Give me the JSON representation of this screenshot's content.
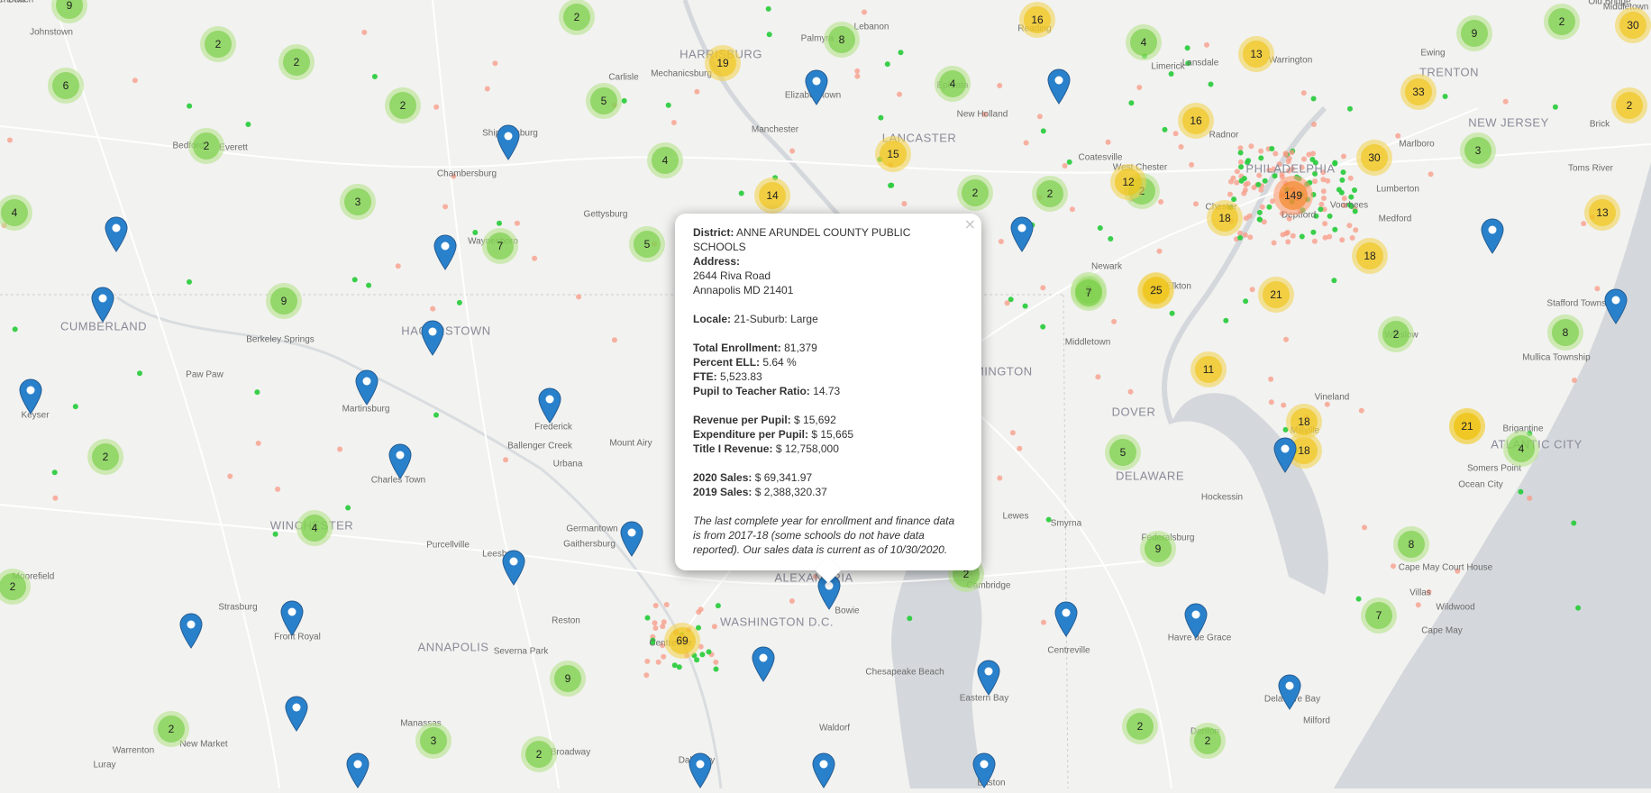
{
  "map": {
    "colors": {
      "land": "#f2f2f0",
      "water": "#d4d8dc",
      "road": "#ffffff",
      "border": "#c9c9c9",
      "dot_red": "#f89a85",
      "dot_green": "#2ecc40",
      "marker_blue": "#2a81cb"
    },
    "place_labels": [
      {
        "text": "Johnstown",
        "big": false
      },
      {
        "text": "Bedford",
        "big": false
      },
      {
        "text": "Everett",
        "big": false
      },
      {
        "text": "Shippensburg",
        "big": false
      },
      {
        "text": "Chambersburg",
        "big": false
      },
      {
        "text": "Waynesboro",
        "big": false
      },
      {
        "text": "Gettysburg",
        "big": false
      },
      {
        "text": "HARRISBURG",
        "big": true
      },
      {
        "text": "Mechanicsburg",
        "big": false
      },
      {
        "text": "Carlisle",
        "big": false
      },
      {
        "text": "Elizabethtown",
        "big": false
      },
      {
        "text": "Palmyra",
        "big": false
      },
      {
        "text": "Lebanon",
        "big": false
      },
      {
        "text": "Reading",
        "big": false
      },
      {
        "text": "Ephrata",
        "big": false
      },
      {
        "text": "New Holland",
        "big": false
      },
      {
        "text": "Manchester",
        "big": false
      },
      {
        "text": "LANCASTER",
        "big": true
      },
      {
        "text": "Limerick",
        "big": false
      },
      {
        "text": "Lansdale",
        "big": false
      },
      {
        "text": "Warrington",
        "big": false
      },
      {
        "text": "Radnor",
        "big": false
      },
      {
        "text": "PHILADELPHIA",
        "big": true
      },
      {
        "text": "West Chester",
        "big": false
      },
      {
        "text": "Coatesville",
        "big": false
      },
      {
        "text": "Chester",
        "big": false
      },
      {
        "text": "Deptford",
        "big": false
      },
      {
        "text": "Voorhees",
        "big": false
      },
      {
        "text": "Lumberton",
        "big": false
      },
      {
        "text": "Medford",
        "big": false
      },
      {
        "text": "TRENTON",
        "big": true
      },
      {
        "text": "Ewing",
        "big": false
      },
      {
        "text": "Middletown",
        "big": false
      },
      {
        "text": "Old Bridge",
        "big": false
      },
      {
        "text": "Marlboro",
        "big": false
      },
      {
        "text": "NEW JERSEY",
        "big": true
      },
      {
        "text": "Brick",
        "big": false
      },
      {
        "text": "Toms River",
        "big": false
      },
      {
        "text": "Stafford Township",
        "big": false
      },
      {
        "text": "Mullica Township",
        "big": false
      },
      {
        "text": "Winslow",
        "big": false
      },
      {
        "text": "Vineland",
        "big": false
      },
      {
        "text": "Millville",
        "big": false
      },
      {
        "text": "Brigantine",
        "big": false
      },
      {
        "text": "ATLANTIC CITY",
        "big": true
      },
      {
        "text": "Somers Point",
        "big": false
      },
      {
        "text": "Ocean City",
        "big": false
      },
      {
        "text": "Cape May Court House",
        "big": false
      },
      {
        "text": "Villas",
        "big": false
      },
      {
        "text": "Wildwood",
        "big": false
      },
      {
        "text": "Cape May",
        "big": false
      },
      {
        "text": "CUMBERLAND",
        "big": true
      },
      {
        "text": "Berkeley Springs",
        "big": false
      },
      {
        "text": "HAGERSTOWN",
        "big": true
      },
      {
        "text": "Paw Paw",
        "big": false
      },
      {
        "text": "Martinsburg",
        "big": false
      },
      {
        "text": "Keyser",
        "big": false
      },
      {
        "text": "Frederick",
        "big": false
      },
      {
        "text": "Ballenger Creek",
        "big": false
      },
      {
        "text": "Urbana",
        "big": false
      },
      {
        "text": "Mount Airy",
        "big": false
      },
      {
        "text": "Charles Town",
        "big": false
      },
      {
        "text": "WINCHESTER",
        "big": true
      },
      {
        "text": "Moorefield",
        "big": false
      },
      {
        "text": "Purcellville",
        "big": false
      },
      {
        "text": "Leesburg",
        "big": false
      },
      {
        "text": "Germantown",
        "big": false
      },
      {
        "text": "Gaithersburg",
        "big": false
      },
      {
        "text": "Strasburg",
        "big": false
      },
      {
        "text": "Front Royal",
        "big": false
      },
      {
        "text": "Reston",
        "big": false
      },
      {
        "text": "Centreville",
        "big": false
      },
      {
        "text": "WASHINGTON D.C.",
        "big": true
      },
      {
        "text": "ALEXANDRIA",
        "big": true
      },
      {
        "text": "Bowie",
        "big": false
      },
      {
        "text": "Severna Park",
        "big": false
      },
      {
        "text": "ANNAPOLIS",
        "big": true
      },
      {
        "text": "Manassas",
        "big": false
      },
      {
        "text": "Warrenton",
        "big": false
      },
      {
        "text": "New Market",
        "big": false
      },
      {
        "text": "Luray",
        "big": false
      },
      {
        "text": "Broadway",
        "big": false
      },
      {
        "text": "Dale City",
        "big": false
      },
      {
        "text": "Waldorf",
        "big": false
      },
      {
        "text": "Chesapeake Beach",
        "big": false
      },
      {
        "text": "Eastern Bay",
        "big": false
      },
      {
        "text": "Easton",
        "big": false
      },
      {
        "text": "Cambridge",
        "big": false
      },
      {
        "text": "Centreville",
        "big": false
      },
      {
        "text": "Denton",
        "big": false
      },
      {
        "text": "Federalsburg",
        "big": false
      },
      {
        "text": "DELAWARE",
        "big": true
      },
      {
        "text": "DOVER",
        "big": true
      },
      {
        "text": "Smyrna",
        "big": false
      },
      {
        "text": "Middletown",
        "big": false
      },
      {
        "text": "Elkton",
        "big": false
      },
      {
        "text": "Newark",
        "big": false
      },
      {
        "text": "WILMINGTON",
        "big": true
      },
      {
        "text": "Hockessin",
        "big": false
      },
      {
        "text": "Havre de Grace",
        "big": false
      },
      {
        "text": "Delaware Bay",
        "big": false
      },
      {
        "text": "Milford",
        "big": false
      },
      {
        "text": "Lewes",
        "big": false
      },
      {
        "text": "Rehoboth Beach",
        "big": false
      },
      {
        "text": "Chestertown",
        "big": false
      }
    ],
    "clusters": [
      "9",
      "2",
      "2",
      "6",
      "2",
      "2",
      "5",
      "3",
      "4",
      "7",
      "5",
      "9",
      "2",
      "2",
      "2",
      "4",
      "2",
      "4",
      "2",
      "2",
      "19",
      "8",
      "16",
      "4",
      "13",
      "4",
      "9",
      "30",
      "15",
      "14",
      "2",
      "2",
      "16",
      "12",
      "18",
      "149",
      "33",
      "30",
      "3",
      "18",
      "21",
      "13",
      "18",
      "25",
      "7",
      "21",
      "2",
      "11",
      "8",
      "18",
      "21",
      "5",
      "4",
      "9",
      "8",
      "7",
      "2",
      "2",
      "69",
      "9",
      "2",
      "3",
      "2",
      "2",
      "2",
      "25"
    ],
    "markers": 30
  },
  "popup": {
    "close_label": "×",
    "district_label": "District:",
    "district_value": "ANNE ARUNDEL COUNTY PUBLIC SCHOOLS",
    "address_label": "Address:",
    "address_line1": "2644 Riva Road",
    "address_line2": "Annapolis MD 21401",
    "locale_label": "Locale:",
    "locale_value": "21-Suburb: Large",
    "enrollment_label": "Total Enrollment:",
    "enrollment_value": "81,379",
    "ell_label": "Percent ELL:",
    "ell_value": "5.64 %",
    "fte_label": "FTE:",
    "fte_value": "5,523.83",
    "ratio_label": "Pupil to Teacher Ratio:",
    "ratio_value": "14.73",
    "revenue_label": "Revenue per Pupil:",
    "revenue_value": "$ 15,692",
    "expenditure_label": "Expenditure per Pupil:",
    "expenditure_value": "$ 15,665",
    "title1_label": "Title I Revenue:",
    "title1_value": "$ 12,758,000",
    "sales2020_label": "2020 Sales:",
    "sales2020_value": "$ 69,341.97",
    "sales2019_label": "2019 Sales:",
    "sales2019_value": "$ 2,388,320.37",
    "note": "The last complete year for enrollment and finance data is from 2017-18 (some schools do not have data reported). Our sales data is current as of 10/30/2020."
  }
}
